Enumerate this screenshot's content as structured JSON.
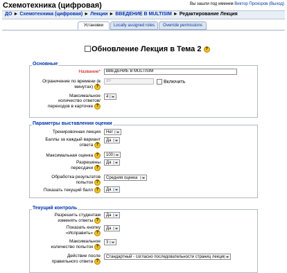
{
  "header": {
    "course_title": "Схемотехника (цифровая)",
    "login_prefix": "Вы зашли под именем",
    "user_name": "Виктор Прохоров",
    "logout": "(Выход)"
  },
  "breadcrumb": {
    "items": [
      "ДО",
      "Схемотехника (цифровая)",
      "Лекции",
      "ВВЕДЕНИЕ В MULTISIM"
    ],
    "current": "Редактирование Лекция",
    "separator": "►"
  },
  "tabs": {
    "settings": "Установки",
    "roles": "Locally assigned roles",
    "overrides": "Override permissions"
  },
  "page": {
    "heading": "Обновление Лекция в Тема 2"
  },
  "sections": {
    "general": {
      "legend": "Основные",
      "name_label": "Название*",
      "name_value": "ВВЕДЕНИЕ В MULTISIM",
      "time_limit_label": "Ограничение по времени (в минутах)",
      "time_limit_value": "20",
      "enable_label": "Включить",
      "max_answers_label": "Максимальное количество ответов/переходов в карточке",
      "max_answers_value": "4"
    },
    "grading": {
      "legend": "Параметры выставления оценки",
      "practice_label": "Тренировочная лекция",
      "practice_value": "Нет",
      "custom_scoring_label": "Баллы за каждый вариант ответа",
      "custom_scoring_value": "Да",
      "max_grade_label": "Максимальная оценка",
      "max_grade_value": "100",
      "retake_label": "Разрешены пересдачи",
      "retake_value": "Да",
      "handling_label": "Обработка результатов попыток",
      "handling_value": "Средняя оценка",
      "show_score_label": "Показать текущий балл",
      "show_score_value": "Да"
    },
    "flow": {
      "legend": "Текущий контроль",
      "review_label": "Разрешить студентам изменять ответы",
      "review_value": "Да",
      "review_button_label": "Показать кнопку «Исправить»",
      "review_button_value": "Да",
      "max_attempts_label": "Максимальное количество попыток",
      "max_attempts_value": "3",
      "action_label": "Действие после правильного ответа",
      "action_value": "Стандартный - согласно последовательности страниц лекции"
    }
  },
  "icons": {
    "help": "help-icon",
    "page": "page-icon"
  },
  "colors": {
    "link": "#0033aa",
    "required": "#cc0000",
    "legend": "#0033aa",
    "help": "#f0c020"
  }
}
